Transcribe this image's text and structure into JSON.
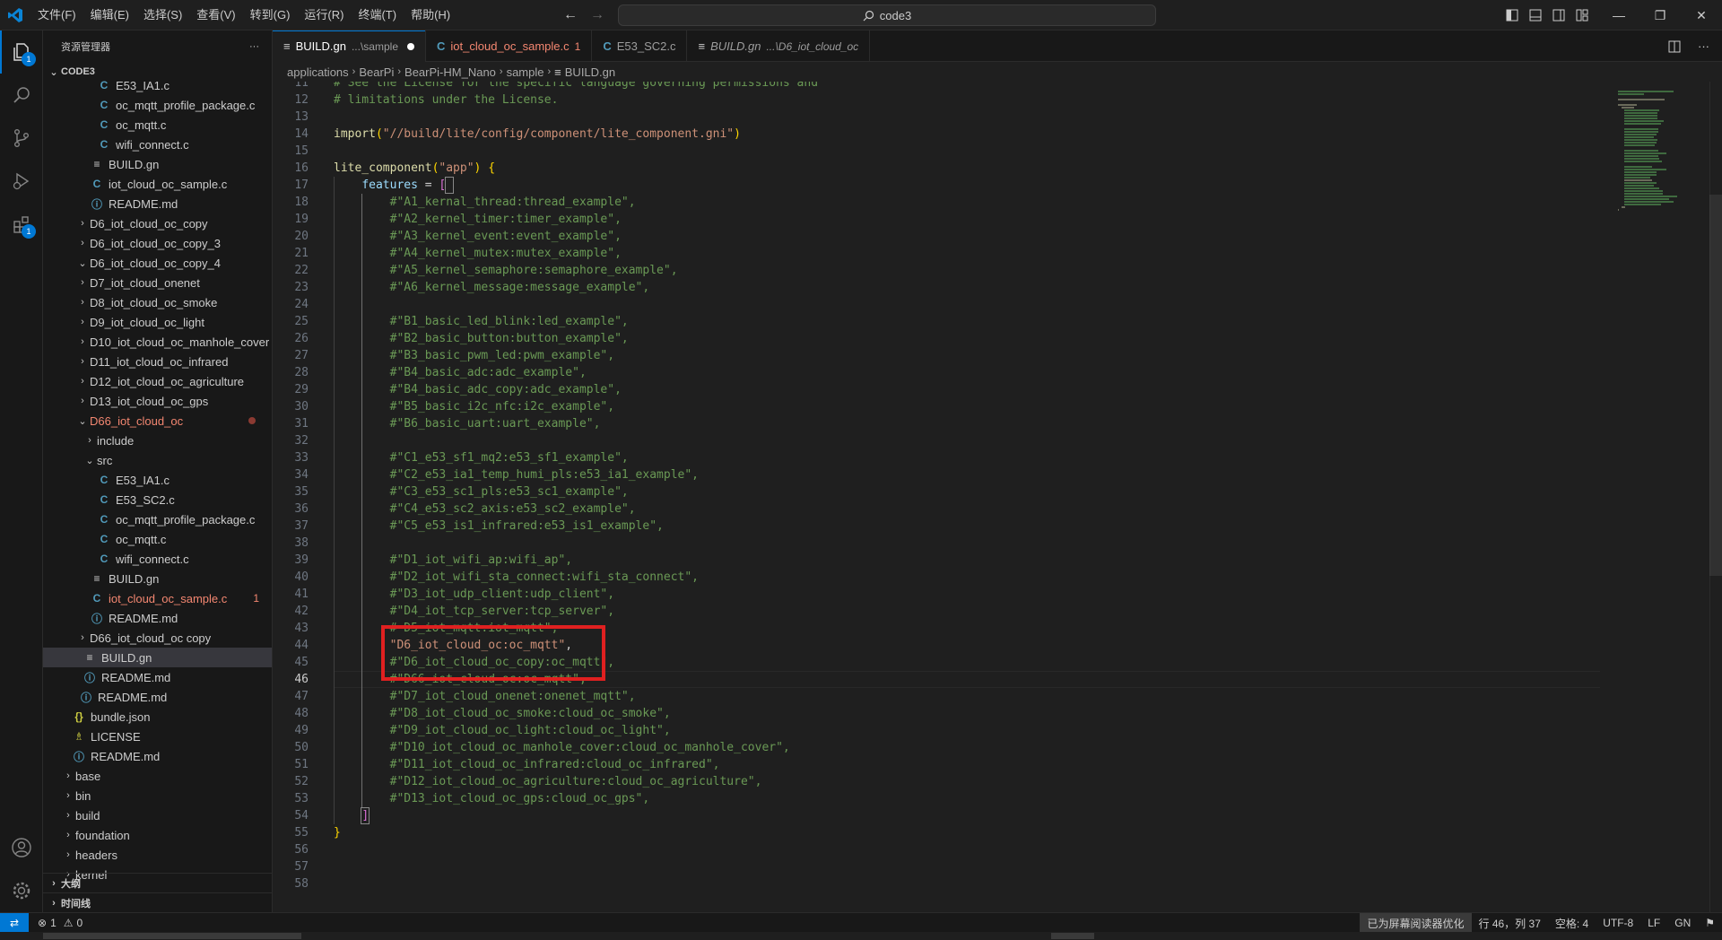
{
  "titlebar": {
    "menu": [
      "文件(F)",
      "编辑(E)",
      "选择(S)",
      "查看(V)",
      "转到(G)",
      "运行(R)",
      "终端(T)",
      "帮助(H)"
    ],
    "search_text": "code3"
  },
  "activitybar": {
    "explorer_badge": "1",
    "extensions_badge": "1"
  },
  "sidebar": {
    "title": "资源管理器",
    "more": "···",
    "root": "CODE3",
    "rows": [
      {
        "label": "E53_IA1.c",
        "icon": "C",
        "type": "c",
        "indent": 3,
        "tw": ""
      },
      {
        "label": "oc_mqtt_profile_package.c",
        "icon": "C",
        "type": "c",
        "indent": 3,
        "tw": ""
      },
      {
        "label": "oc_mqtt.c",
        "icon": "C",
        "type": "c",
        "indent": 3,
        "tw": ""
      },
      {
        "label": "wifi_connect.c",
        "icon": "C",
        "type": "c",
        "indent": 3,
        "tw": ""
      },
      {
        "label": "BUILD.gn",
        "icon": "≡",
        "type": "gn",
        "indent": 2,
        "tw": ""
      },
      {
        "label": "iot_cloud_oc_sample.c",
        "icon": "C",
        "type": "c",
        "indent": 2,
        "tw": ""
      },
      {
        "label": "README.md",
        "icon": "ⓘ",
        "type": "md",
        "indent": 2,
        "tw": ""
      },
      {
        "label": "D6_iot_cloud_oc_copy",
        "indent": 1,
        "tw": "›"
      },
      {
        "label": "D6_iot_cloud_oc_copy_3",
        "indent": 1,
        "tw": "›"
      },
      {
        "label": "D6_iot_cloud_oc_copy_4",
        "indent": 1,
        "tw": "⌄"
      },
      {
        "label": "D7_iot_cloud_onenet",
        "indent": 1,
        "tw": "›"
      },
      {
        "label": "D8_iot_cloud_oc_smoke",
        "indent": 1,
        "tw": "›"
      },
      {
        "label": "D9_iot_cloud_oc_light",
        "indent": 1,
        "tw": "›"
      },
      {
        "label": "D10_iot_cloud_oc_manhole_cover",
        "indent": 1,
        "tw": "›"
      },
      {
        "label": "D11_iot_cloud_oc_infrared",
        "indent": 1,
        "tw": "›"
      },
      {
        "label": "D12_iot_cloud_oc_agriculture",
        "indent": 1,
        "tw": "›"
      },
      {
        "label": "D13_iot_cloud_oc_gps",
        "indent": 1,
        "tw": "›"
      },
      {
        "label": "D66_iot_cloud_oc",
        "indent": 1,
        "tw": "⌄",
        "modified": true,
        "dot": true
      },
      {
        "label": "include",
        "indent": 2,
        "tw": "›"
      },
      {
        "label": "src",
        "indent": 2,
        "tw": "⌄"
      },
      {
        "label": "E53_IA1.c",
        "icon": "C",
        "type": "c",
        "indent": 3,
        "tw": ""
      },
      {
        "label": "E53_SC2.c",
        "icon": "C",
        "type": "c",
        "indent": 3,
        "tw": ""
      },
      {
        "label": "oc_mqtt_profile_package.c",
        "icon": "C",
        "type": "c",
        "indent": 3,
        "tw": ""
      },
      {
        "label": "oc_mqtt.c",
        "icon": "C",
        "type": "c",
        "indent": 3,
        "tw": ""
      },
      {
        "label": "wifi_connect.c",
        "icon": "C",
        "type": "c",
        "indent": 3,
        "tw": ""
      },
      {
        "label": "BUILD.gn",
        "icon": "≡",
        "type": "gn",
        "indent": 2,
        "tw": ""
      },
      {
        "label": "iot_cloud_oc_sample.c",
        "icon": "C",
        "type": "c",
        "indent": 2,
        "tw": "",
        "modified": true,
        "num": "1"
      },
      {
        "label": "README.md",
        "icon": "ⓘ",
        "type": "md",
        "indent": 2,
        "tw": ""
      },
      {
        "label": "D66_iot_cloud_oc copy",
        "indent": 1,
        "tw": "›"
      },
      {
        "label": "BUILD.gn",
        "icon": "≡",
        "type": "gn",
        "indent": 1,
        "tw": "",
        "selected": true
      },
      {
        "label": "README.md",
        "icon": "ⓘ",
        "type": "md",
        "indent": 1,
        "tw": ""
      },
      {
        "label": "README.md",
        "icon": "ⓘ",
        "type": "md",
        "indent": 0.5,
        "tw": ""
      },
      {
        "label": "bundle.json",
        "icon": "{}",
        "type": "json",
        "indent": -0.5,
        "tw": ""
      },
      {
        "label": "LICENSE",
        "icon": "♗",
        "type": "lic",
        "indent": -0.5,
        "tw": ""
      },
      {
        "label": "README.md",
        "icon": "ⓘ",
        "type": "md",
        "indent": -0.5,
        "tw": ""
      },
      {
        "label": "base",
        "indent": -1,
        "tw": "›"
      },
      {
        "label": "bin",
        "indent": -1,
        "tw": "›"
      },
      {
        "label": "build",
        "indent": -1,
        "tw": "›"
      },
      {
        "label": "foundation",
        "indent": -1,
        "tw": "›"
      },
      {
        "label": "headers",
        "indent": -1,
        "tw": "›"
      },
      {
        "label": "kernel",
        "indent": -1,
        "tw": "›"
      }
    ],
    "outline": "大纲",
    "timeline": "时间线"
  },
  "tabs": [
    {
      "name": "BUILD.gn",
      "desc": "...\\sample",
      "active": true,
      "dirty": true,
      "icon": "≡"
    },
    {
      "name": "iot_cloud_oc_sample.c",
      "err": "1",
      "icon": "C"
    },
    {
      "name": "E53_SC2.c",
      "icon": "C"
    },
    {
      "name": "BUILD.gn",
      "desc": "...\\D6_iot_cloud_oc",
      "italic": true,
      "icon": "≡"
    }
  ],
  "breadcrumb": [
    "applications",
    "BearPi",
    "BearPi-HM_Nano",
    "sample",
    "BUILD.gn"
  ],
  "code": {
    "current_line": 46,
    "lines": [
      {
        "n": 11,
        "parts": [
          [
            "c",
            "# See the License for the specific language governing permissions and"
          ]
        ]
      },
      {
        "n": 12,
        "parts": [
          [
            "c",
            "# limitations under the License."
          ]
        ]
      },
      {
        "n": 13,
        "parts": []
      },
      {
        "n": 14,
        "parts": [
          [
            "f",
            "import"
          ],
          [
            "b1",
            "("
          ],
          [
            "s",
            "\"//build/lite/config/component/lite_component.gni\""
          ],
          [
            "b1",
            ")"
          ]
        ]
      },
      {
        "n": 15,
        "parts": []
      },
      {
        "n": 16,
        "parts": [
          [
            "f",
            "lite_component"
          ],
          [
            "b1",
            "("
          ],
          [
            "s",
            "\"app\""
          ],
          [
            "b1",
            ")"
          ],
          [
            "p",
            " "
          ],
          [
            "b1",
            "{"
          ]
        ]
      },
      {
        "n": 17,
        "parts": [
          [
            "p",
            "    "
          ],
          [
            "v",
            "features"
          ],
          [
            "p",
            " = "
          ],
          [
            "b2",
            "["
          ]
        ]
      },
      {
        "n": 18,
        "parts": [
          [
            "p",
            "        "
          ],
          [
            "c",
            "#\"A1_kernal_thread:thread_example\","
          ]
        ]
      },
      {
        "n": 19,
        "parts": [
          [
            "p",
            "        "
          ],
          [
            "c",
            "#\"A2_kernel_timer:timer_example\","
          ]
        ]
      },
      {
        "n": 20,
        "parts": [
          [
            "p",
            "        "
          ],
          [
            "c",
            "#\"A3_kernel_event:event_example\","
          ]
        ]
      },
      {
        "n": 21,
        "parts": [
          [
            "p",
            "        "
          ],
          [
            "c",
            "#\"A4_kernel_mutex:mutex_example\","
          ]
        ]
      },
      {
        "n": 22,
        "parts": [
          [
            "p",
            "        "
          ],
          [
            "c",
            "#\"A5_kernel_semaphore:semaphore_example\","
          ]
        ]
      },
      {
        "n": 23,
        "parts": [
          [
            "p",
            "        "
          ],
          [
            "c",
            "#\"A6_kernel_message:message_example\","
          ]
        ]
      },
      {
        "n": 24,
        "parts": []
      },
      {
        "n": 25,
        "parts": [
          [
            "p",
            "        "
          ],
          [
            "c",
            "#\"B1_basic_led_blink:led_example\","
          ]
        ]
      },
      {
        "n": 26,
        "parts": [
          [
            "p",
            "        "
          ],
          [
            "c",
            "#\"B2_basic_button:button_example\","
          ]
        ]
      },
      {
        "n": 27,
        "parts": [
          [
            "p",
            "        "
          ],
          [
            "c",
            "#\"B3_basic_pwm_led:pwm_example\","
          ]
        ]
      },
      {
        "n": 28,
        "parts": [
          [
            "p",
            "        "
          ],
          [
            "c",
            "#\"B4_basic_adc:adc_example\","
          ]
        ]
      },
      {
        "n": 29,
        "parts": [
          [
            "p",
            "        "
          ],
          [
            "c",
            "#\"B4_basic_adc_copy:adc_example\","
          ]
        ]
      },
      {
        "n": 30,
        "parts": [
          [
            "p",
            "        "
          ],
          [
            "c",
            "#\"B5_basic_i2c_nfc:i2c_example\","
          ]
        ]
      },
      {
        "n": 31,
        "parts": [
          [
            "p",
            "        "
          ],
          [
            "c",
            "#\"B6_basic_uart:uart_example\","
          ]
        ]
      },
      {
        "n": 32,
        "parts": []
      },
      {
        "n": 33,
        "parts": [
          [
            "p",
            "        "
          ],
          [
            "c",
            "#\"C1_e53_sf1_mq2:e53_sf1_example\","
          ]
        ]
      },
      {
        "n": 34,
        "parts": [
          [
            "p",
            "        "
          ],
          [
            "c",
            "#\"C2_e53_ia1_temp_humi_pls:e53_ia1_example\","
          ]
        ]
      },
      {
        "n": 35,
        "parts": [
          [
            "p",
            "        "
          ],
          [
            "c",
            "#\"C3_e53_sc1_pls:e53_sc1_example\","
          ]
        ]
      },
      {
        "n": 36,
        "parts": [
          [
            "p",
            "        "
          ],
          [
            "c",
            "#\"C4_e53_sc2_axis:e53_sc2_example\","
          ]
        ]
      },
      {
        "n": 37,
        "parts": [
          [
            "p",
            "        "
          ],
          [
            "c",
            "#\"C5_e53_is1_infrared:e53_is1_example\","
          ]
        ]
      },
      {
        "n": 38,
        "parts": []
      },
      {
        "n": 39,
        "parts": [
          [
            "p",
            "        "
          ],
          [
            "c",
            "#\"D1_iot_wifi_ap:wifi_ap\","
          ]
        ]
      },
      {
        "n": 40,
        "parts": [
          [
            "p",
            "        "
          ],
          [
            "c",
            "#\"D2_iot_wifi_sta_connect:wifi_sta_connect\","
          ]
        ]
      },
      {
        "n": 41,
        "parts": [
          [
            "p",
            "        "
          ],
          [
            "c",
            "#\"D3_iot_udp_client:udp_client\","
          ]
        ]
      },
      {
        "n": 42,
        "parts": [
          [
            "p",
            "        "
          ],
          [
            "c",
            "#\"D4_iot_tcp_server:tcp_server\","
          ]
        ]
      },
      {
        "n": 43,
        "parts": [
          [
            "p",
            "        "
          ],
          [
            "c",
            "# D5_iot_mqtt:iot_mqtt\","
          ]
        ]
      },
      {
        "n": 44,
        "parts": [
          [
            "p",
            "        "
          ],
          [
            "s",
            "\"D6_iot_cloud_oc:oc_mqtt\""
          ],
          [
            "p",
            ","
          ]
        ]
      },
      {
        "n": 45,
        "parts": [
          [
            "p",
            "        "
          ],
          [
            "c",
            "#\"D6_iot_cloud_oc_copy:oc_mqtt\","
          ]
        ]
      },
      {
        "n": 46,
        "parts": [
          [
            "p",
            "        "
          ],
          [
            "c",
            "#\"D66_iot_cloud_oc:oc_mqtt\","
          ]
        ]
      },
      {
        "n": 47,
        "parts": [
          [
            "p",
            "        "
          ],
          [
            "c",
            "#\"D7_iot_cloud_onenet:onenet_mqtt\","
          ]
        ]
      },
      {
        "n": 48,
        "parts": [
          [
            "p",
            "        "
          ],
          [
            "c",
            "#\"D8_iot_cloud_oc_smoke:cloud_oc_smoke\","
          ]
        ]
      },
      {
        "n": 49,
        "parts": [
          [
            "p",
            "        "
          ],
          [
            "c",
            "#\"D9_iot_cloud_oc_light:cloud_oc_light\","
          ]
        ]
      },
      {
        "n": 50,
        "parts": [
          [
            "p",
            "        "
          ],
          [
            "c",
            "#\"D10_iot_cloud_oc_manhole_cover:cloud_oc_manhole_cover\","
          ]
        ]
      },
      {
        "n": 51,
        "parts": [
          [
            "p",
            "        "
          ],
          [
            "c",
            "#\"D11_iot_cloud_oc_infrared:cloud_oc_infrared\","
          ]
        ]
      },
      {
        "n": 52,
        "parts": [
          [
            "p",
            "        "
          ],
          [
            "c",
            "#\"D12_iot_cloud_oc_agriculture:cloud_oc_agriculture\","
          ]
        ]
      },
      {
        "n": 53,
        "parts": [
          [
            "p",
            "        "
          ],
          [
            "c",
            "#\"D13_iot_cloud_oc_gps:cloud_oc_gps\","
          ]
        ]
      },
      {
        "n": 54,
        "parts": [
          [
            "p",
            "    "
          ],
          [
            "b2",
            "]"
          ]
        ]
      },
      {
        "n": 55,
        "parts": [
          [
            "b1",
            "}"
          ]
        ]
      },
      {
        "n": 56,
        "parts": []
      },
      {
        "n": 57,
        "parts": []
      },
      {
        "n": 58,
        "parts": []
      }
    ]
  },
  "statusbar": {
    "errors": "1",
    "warnings": "0",
    "accessibility": "已为屏幕阅读器优化",
    "position": "行 46，列 37",
    "spaces": "空格: 4",
    "encoding": "UTF-8",
    "eol": "LF",
    "language": "GN"
  }
}
